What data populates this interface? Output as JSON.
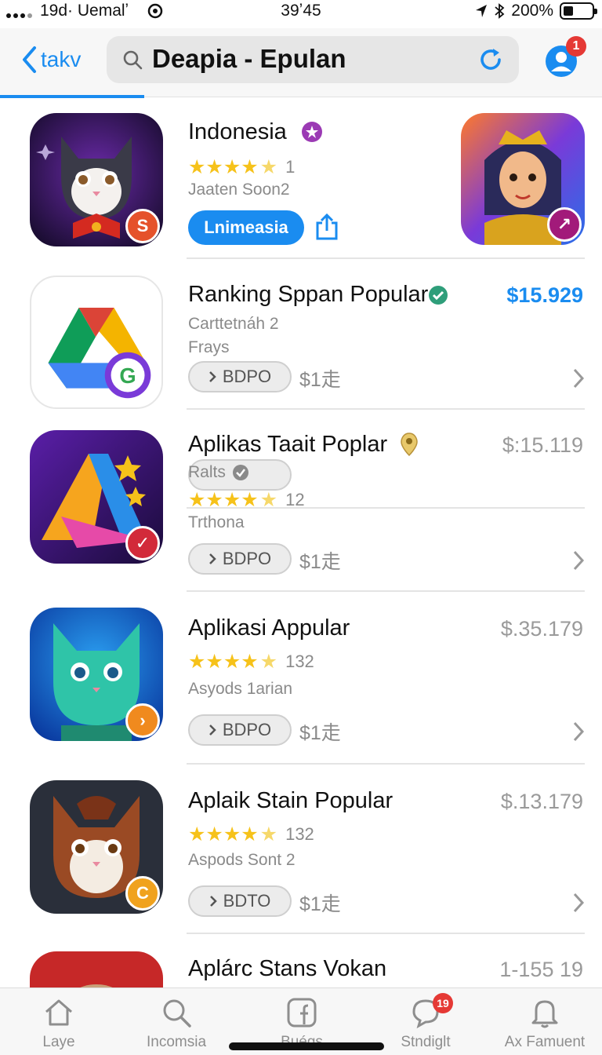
{
  "status_bar": {
    "carrier": "19d· Uemalʼ",
    "time": "39ʼ45",
    "battery_text": "200%"
  },
  "nav": {
    "back_label": "takv",
    "search_query": "Deapia - Epulan",
    "profile_badge": "1"
  },
  "apps": [
    {
      "title": "Indonesia",
      "rating_count": "1",
      "subtitle": "Jaaten Soon2",
      "button_label": "Lnimeasia",
      "icon_badge": "S"
    },
    {
      "title": "Ranking Sppan Popular",
      "price": "$15.929",
      "developer": "Carttetnáh 2",
      "category": "Frays",
      "get_label": "BDPO",
      "extra": "$1走"
    },
    {
      "title": "Aplikas Taait Poplar",
      "price": "$:15.119",
      "developer": "Ralts",
      "rating_count": "12",
      "category": "Trthona",
      "get_label": "BDPO",
      "extra": "$1走"
    },
    {
      "title": "Aplikasi Appular",
      "price": "$.35.179",
      "rating_count": "132",
      "category": "Asyods 1arian",
      "get_label": "BDPO",
      "extra": "$1走"
    },
    {
      "title": "Aplaik Stain Popular",
      "price": "$.13.179",
      "rating_count": "132",
      "category": "Aspods Sont 2",
      "get_label": "BDTO",
      "extra": "$1走"
    },
    {
      "title": "Aplárc Stans Vokan",
      "price": "1-155 19"
    }
  ],
  "tabs": [
    {
      "label": "Laye",
      "icon": "home-icon"
    },
    {
      "label": "Incomsia",
      "icon": "search-icon"
    },
    {
      "label": "Buégs",
      "icon": "facebook-icon"
    },
    {
      "label": "Stndiglt",
      "icon": "chat-icon",
      "badge": "19"
    },
    {
      "label": "Ax Famuent",
      "icon": "bell-icon"
    }
  ],
  "colors": {
    "accent": "#1a8cf0",
    "star": "#f6c21a",
    "badge_red": "#e53935"
  }
}
